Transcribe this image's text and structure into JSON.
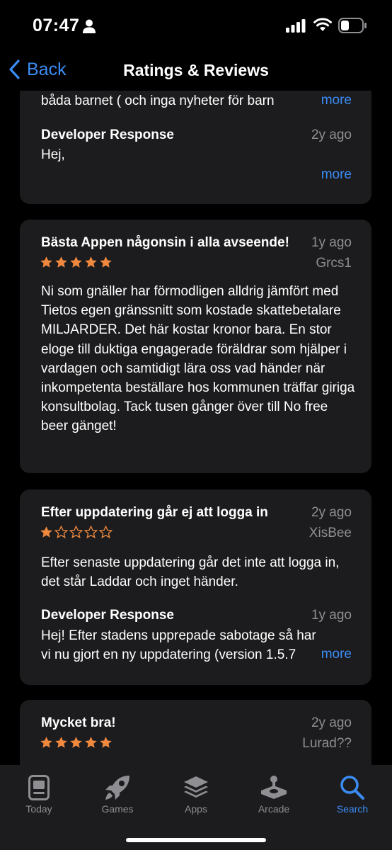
{
  "status": {
    "time": "07:47"
  },
  "nav": {
    "back_label": "Back",
    "title": "Ratings & Reviews"
  },
  "reviews": [
    {
      "partial_text": "båda barnet  ( och inga nyheter för barn",
      "more_label": "more",
      "developer_response": {
        "title": "Developer Response",
        "date": "2y ago",
        "text": "Hej,",
        "more_label": "more"
      }
    },
    {
      "title": "Bästa Appen någonsin i alla avseende!",
      "date": "1y ago",
      "author": "Grcs1",
      "rating": 5,
      "text": "Ni som gnäller har förmodligen alldrig jämfört med Tietos egen gränssnitt som kostade skattebetalare MILJARDER. Det här kostar kronor bara. En stor eloge till duktiga engagerade föräldrar som hjälper i vardagen och samtidigt lära oss vad händer när inkompetenta beställare hos kommunen träffar giriga konsultbolag. Tack tusen gånger över till No free beer gänget!"
    },
    {
      "title": "Efter uppdatering går ej att logga in",
      "date": "2y ago",
      "author": "XisBee",
      "rating": 1,
      "text": "Efter senaste uppdatering går det inte att logga in, det står Laddar och inget händer.",
      "developer_response": {
        "title": "Developer Response",
        "date": "1y ago",
        "text_line1": "Hej! Efter stadens upprepade sabotage så har",
        "text_line2": "vi nu gjort en ny uppdatering (version 1.5.7",
        "more_label": "more"
      }
    },
    {
      "title": "Mycket bra!",
      "date": "2y ago",
      "author": "Lurad??",
      "rating": 5
    }
  ],
  "tabs": [
    {
      "label": "Today",
      "icon": "today-icon"
    },
    {
      "label": "Games",
      "icon": "rocket-icon"
    },
    {
      "label": "Apps",
      "icon": "stack-icon"
    },
    {
      "label": "Arcade",
      "icon": "joystick-icon"
    },
    {
      "label": "Search",
      "icon": "search-icon",
      "active": true
    }
  ],
  "colors": {
    "accent": "#3b8cf5",
    "star": "#f0883e",
    "card": "#1c1c1e",
    "secondary": "#8e8e93"
  }
}
